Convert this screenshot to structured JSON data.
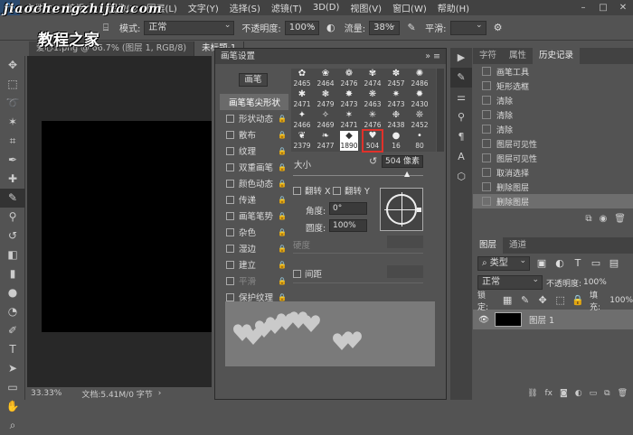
{
  "watermark": {
    "line1": "jiaochengzhijia.com",
    "line2": "教程之家"
  },
  "menu": [
    "文件(F)",
    "编辑(E)",
    "图像(I)",
    "图层(L)",
    "文字(Y)",
    "选择(S)",
    "滤镜(T)",
    "3D(D)",
    "视图(V)",
    "窗口(W)",
    "帮助(H)"
  ],
  "options": {
    "mode_label": "模式:",
    "mode_value": "正常",
    "opacity_label": "不透明度:",
    "opacity_value": "100%",
    "flow_label": "流量:",
    "flow_value": "38%",
    "smooth_label": "平滑:"
  },
  "tabs": [
    "爱心1.png @ 66.7% (图层 1, RGB/8)",
    "未标题-1"
  ],
  "status": {
    "zoom": "33.33%",
    "doc": "文档:5.41M/0 字节"
  },
  "brush": {
    "title": "画笔设置",
    "preset_button": "画笔",
    "head": "画笔笔尖形状",
    "items": [
      "形状动态",
      "散布",
      "纹理",
      "双重画笔",
      "颜色动态",
      "传递",
      "画笔笔势",
      "杂色",
      "湿边",
      "建立",
      "平滑",
      "保护纹理"
    ],
    "grid_sizes": [
      [
        "2465",
        "2464",
        "2476",
        "2474",
        "2457",
        "2486"
      ],
      [
        "2471",
        "2479",
        "2473",
        "2463",
        "2473",
        "2430"
      ],
      [
        "2466",
        "2469",
        "2471",
        "2476",
        "2438",
        "2452"
      ],
      [
        "2379",
        "2477",
        "1890",
        "504",
        "16",
        "80"
      ]
    ],
    "size_label": "大小",
    "size_value": "504 像素",
    "flip_x": "翻转 X",
    "flip_y": "翻转 Y",
    "angle_label": "角度:",
    "angle_value": "0°",
    "round_label": "圆度:",
    "round_value": "100%",
    "hardness_label": "硬度",
    "spacing_label": "间距"
  },
  "right": {
    "tabs": [
      "字符",
      "属性",
      "历史记录"
    ],
    "history": [
      "画笔工具",
      "矩形选框",
      "清除",
      "清除",
      "清除",
      "图层可见性",
      "图层可见性",
      "取消选择",
      "删除图层",
      "删除图层"
    ],
    "layer_tabs": [
      "图层",
      "通道"
    ],
    "kind_label": "类型",
    "blend": "正常",
    "opacity_label": "不透明度:",
    "opacity_value": "100%",
    "lock_label": "锁定:",
    "fill_label": "填充:",
    "fill_value": "100%",
    "layer_name": "图层 1"
  }
}
